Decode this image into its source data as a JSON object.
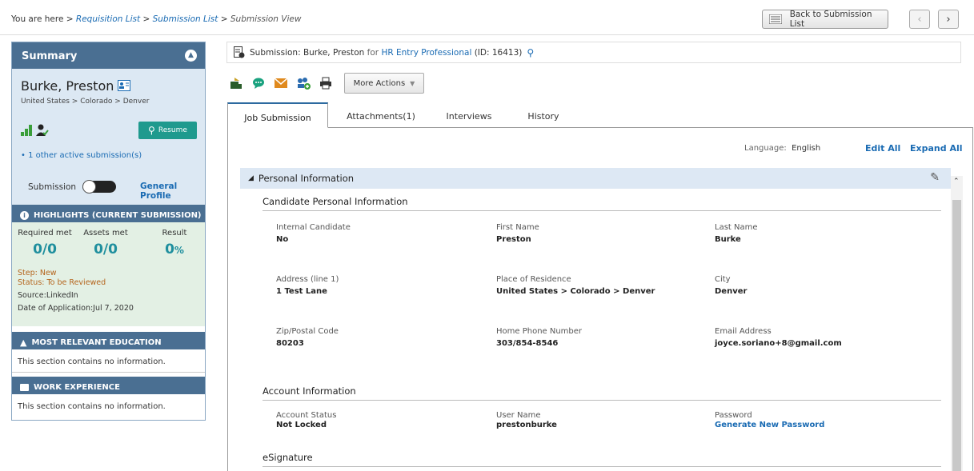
{
  "breadcrumb": {
    "prefix": "You are here",
    "sep": ">",
    "items": [
      "Requisition List",
      "Submission List"
    ],
    "current": "Submission View"
  },
  "topbar": {
    "back_label": "Back to Submission List",
    "prev_icon": "chevron-left-icon",
    "next_icon": "chevron-right-icon"
  },
  "summary": {
    "title": "Summary",
    "candidate_name": "Burke, Preston",
    "location": "United States > Colorado > Denver",
    "resume_label": "Resume",
    "other_submissions": "1 other active submission(s)",
    "toggle_left": "Submission",
    "toggle_right": "General Profile"
  },
  "highlights": {
    "title": "HIGHLIGHTS (CURRENT SUBMISSION)",
    "required_label": "Required met",
    "required_value": "0/0",
    "assets_label": "Assets met",
    "assets_value": "0/0",
    "result_label": "Result",
    "result_value": "0",
    "result_unit": "%",
    "step": "Step: New",
    "status": "Status: To be Reviewed",
    "source": "Source:LinkedIn",
    "date": "Date of Application:Jul 7, 2020"
  },
  "education": {
    "title": "MOST RELEVANT EDUCATION",
    "text": "This section contains no information."
  },
  "work": {
    "title": "WORK EXPERIENCE",
    "text": "This section contains no information."
  },
  "submission_header": {
    "prefix": "Submission: Burke, Preston",
    "for": "for",
    "job": "HR Entry Professional",
    "id": "(ID: 16413)"
  },
  "toolbar": {
    "more_actions": "More Actions"
  },
  "tabs": [
    "Job Submission",
    "Attachments(1)",
    "Interviews",
    "History"
  ],
  "content": {
    "language_label": "Language:",
    "language_value": "English",
    "edit_all": "Edit All",
    "expand_all": "Expand All",
    "section_title": "Personal Information",
    "cpi_title": "Candidate Personal Information",
    "fields": [
      {
        "label": "Internal Candidate",
        "value": "No"
      },
      {
        "label": "First Name",
        "value": "Preston"
      },
      {
        "label": "Last Name",
        "value": "Burke"
      },
      {
        "label": "Address (line 1)",
        "value": "1 Test Lane"
      },
      {
        "label": "Place of Residence",
        "value": "United States > Colorado > Denver"
      },
      {
        "label": "City",
        "value": "Denver"
      },
      {
        "label": "Zip/Postal Code",
        "value": "80203"
      },
      {
        "label": "Home Phone Number",
        "value": "303/854-8546"
      },
      {
        "label": "Email Address",
        "value": "joyce.soriano+8@gmail.com"
      }
    ],
    "account_title": "Account Information",
    "account_fields": [
      {
        "label": "Account Status",
        "value": "Not Locked"
      },
      {
        "label": "User Name",
        "value": "prestonburke"
      },
      {
        "label": "Password",
        "value": "Generate New Password"
      }
    ],
    "esignature_title": "eSignature"
  },
  "colors": {
    "header_blue": "#4a6f92",
    "link": "#1a6bb3",
    "resume_teal": "#1f9a8e",
    "metric_teal": "#1f8f9e",
    "status_orange": "#b5651d"
  }
}
